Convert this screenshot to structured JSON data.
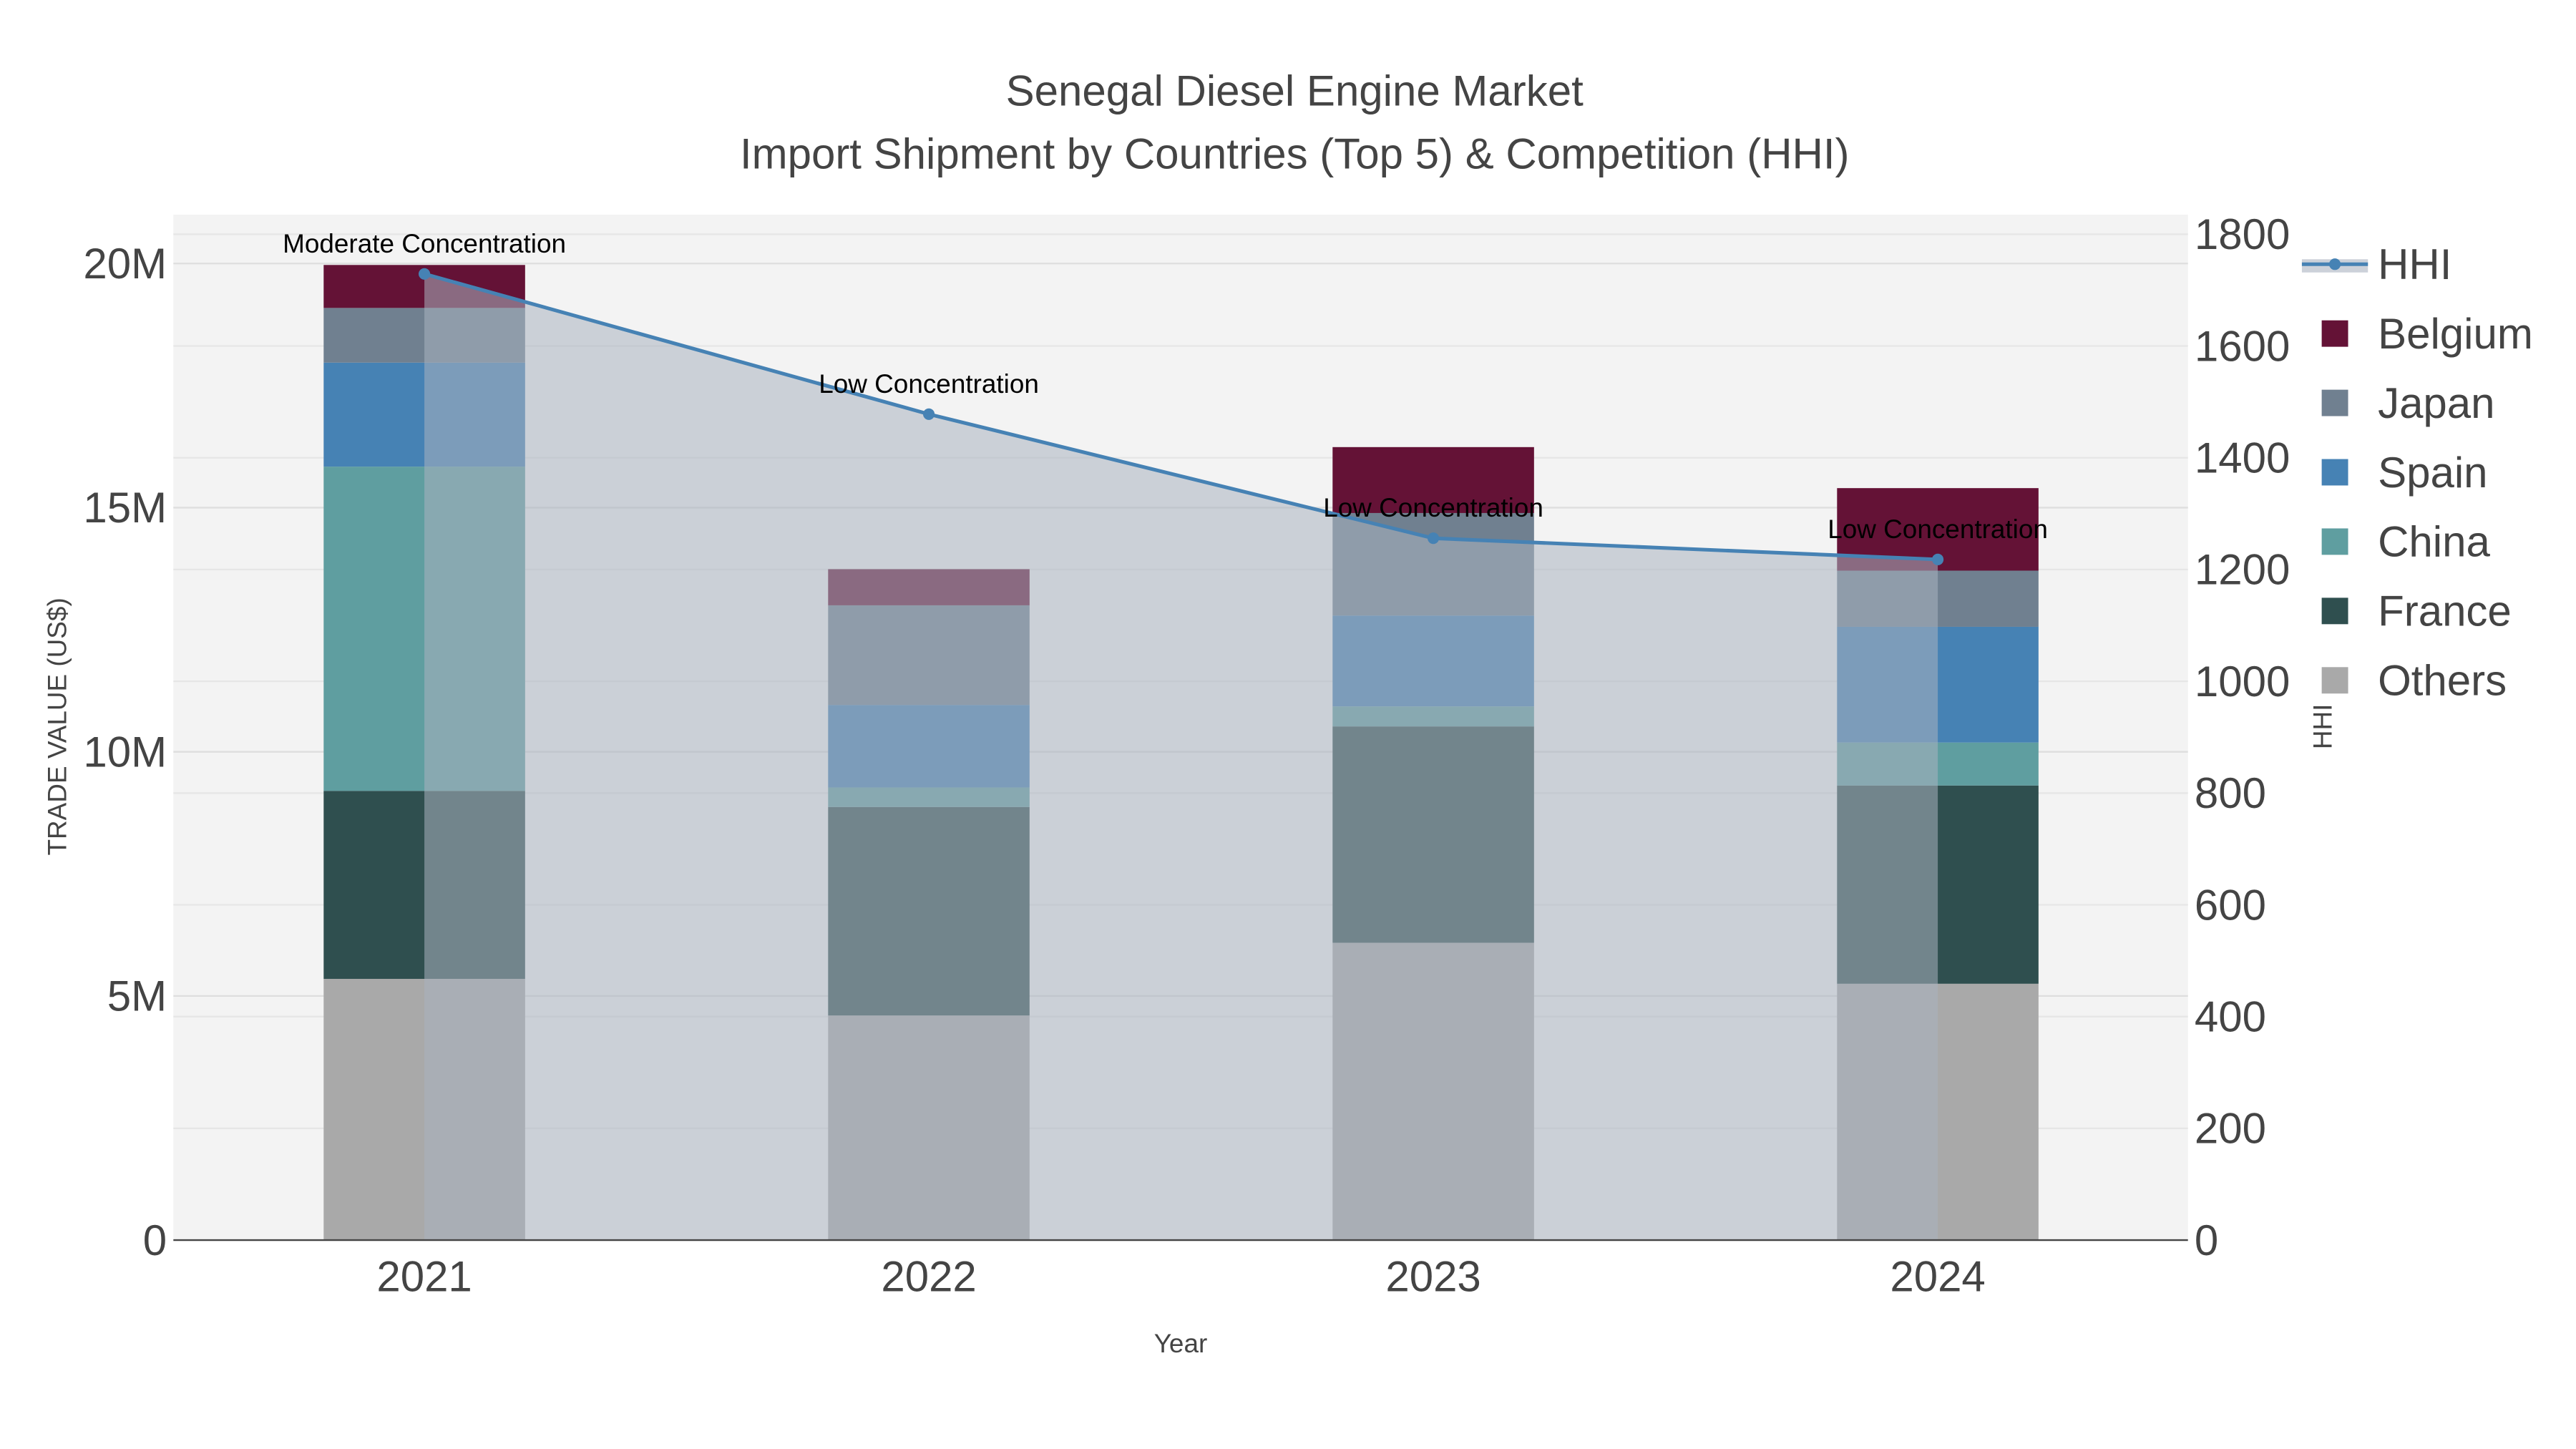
{
  "chart_data": {
    "type": "bar",
    "stacked": true,
    "title": "Senegal Diesel Engine Market",
    "subtitle": "Import Shipment by Countries (Top 5) & Competition (HHI)",
    "xlabel": "Year",
    "ylabel": "TRADE VALUE (US$)",
    "y2label": "HHI",
    "categories": [
      "2021",
      "2022",
      "2023",
      "2024"
    ],
    "ylim": [
      0,
      21000000
    ],
    "y_ticks": [
      0,
      5000000,
      10000000,
      15000000,
      20000000
    ],
    "y_tick_labels": [
      "0",
      "5M",
      "10M",
      "15M",
      "20M"
    ],
    "y2lim": [
      0,
      1835
    ],
    "y2_ticks": [
      0,
      200,
      400,
      600,
      800,
      1000,
      1200,
      1400,
      1600,
      1800
    ],
    "y2_tick_labels": [
      "0",
      "200",
      "400",
      "600",
      "800",
      "1000",
      "1200",
      "1400",
      "1600",
      "1800"
    ],
    "legend_placement": "right",
    "series": [
      {
        "name": "Others",
        "color": "#a9a9a9",
        "values": [
          5350000,
          4600000,
          6090000,
          5250000
        ]
      },
      {
        "name": "France",
        "color": "#2f4f4f",
        "values": [
          3850000,
          4270000,
          4430000,
          4060000
        ]
      },
      {
        "name": "China",
        "color": "#5f9ea0",
        "values": [
          6640000,
          400000,
          410000,
          880000
        ]
      },
      {
        "name": "Spain",
        "color": "#4682b4",
        "values": [
          2130000,
          1690000,
          1860000,
          2370000
        ]
      },
      {
        "name": "Japan",
        "color": "#708090",
        "values": [
          1120000,
          2040000,
          2100000,
          1150000
        ]
      },
      {
        "name": "Belgium",
        "color": "#641236",
        "values": [
          880000,
          740000,
          1350000,
          1690000
        ]
      }
    ],
    "hhi": {
      "name": "HHI",
      "color": "#4682b4",
      "values": [
        1729,
        1478,
        1256,
        1218
      ],
      "annotations": [
        "Moderate Concentration",
        "Low Concentration",
        "Low Concentration",
        "Low Concentration"
      ]
    },
    "legend_order": [
      "HHI",
      "Belgium",
      "Japan",
      "Spain",
      "China",
      "France",
      "Others"
    ]
  }
}
